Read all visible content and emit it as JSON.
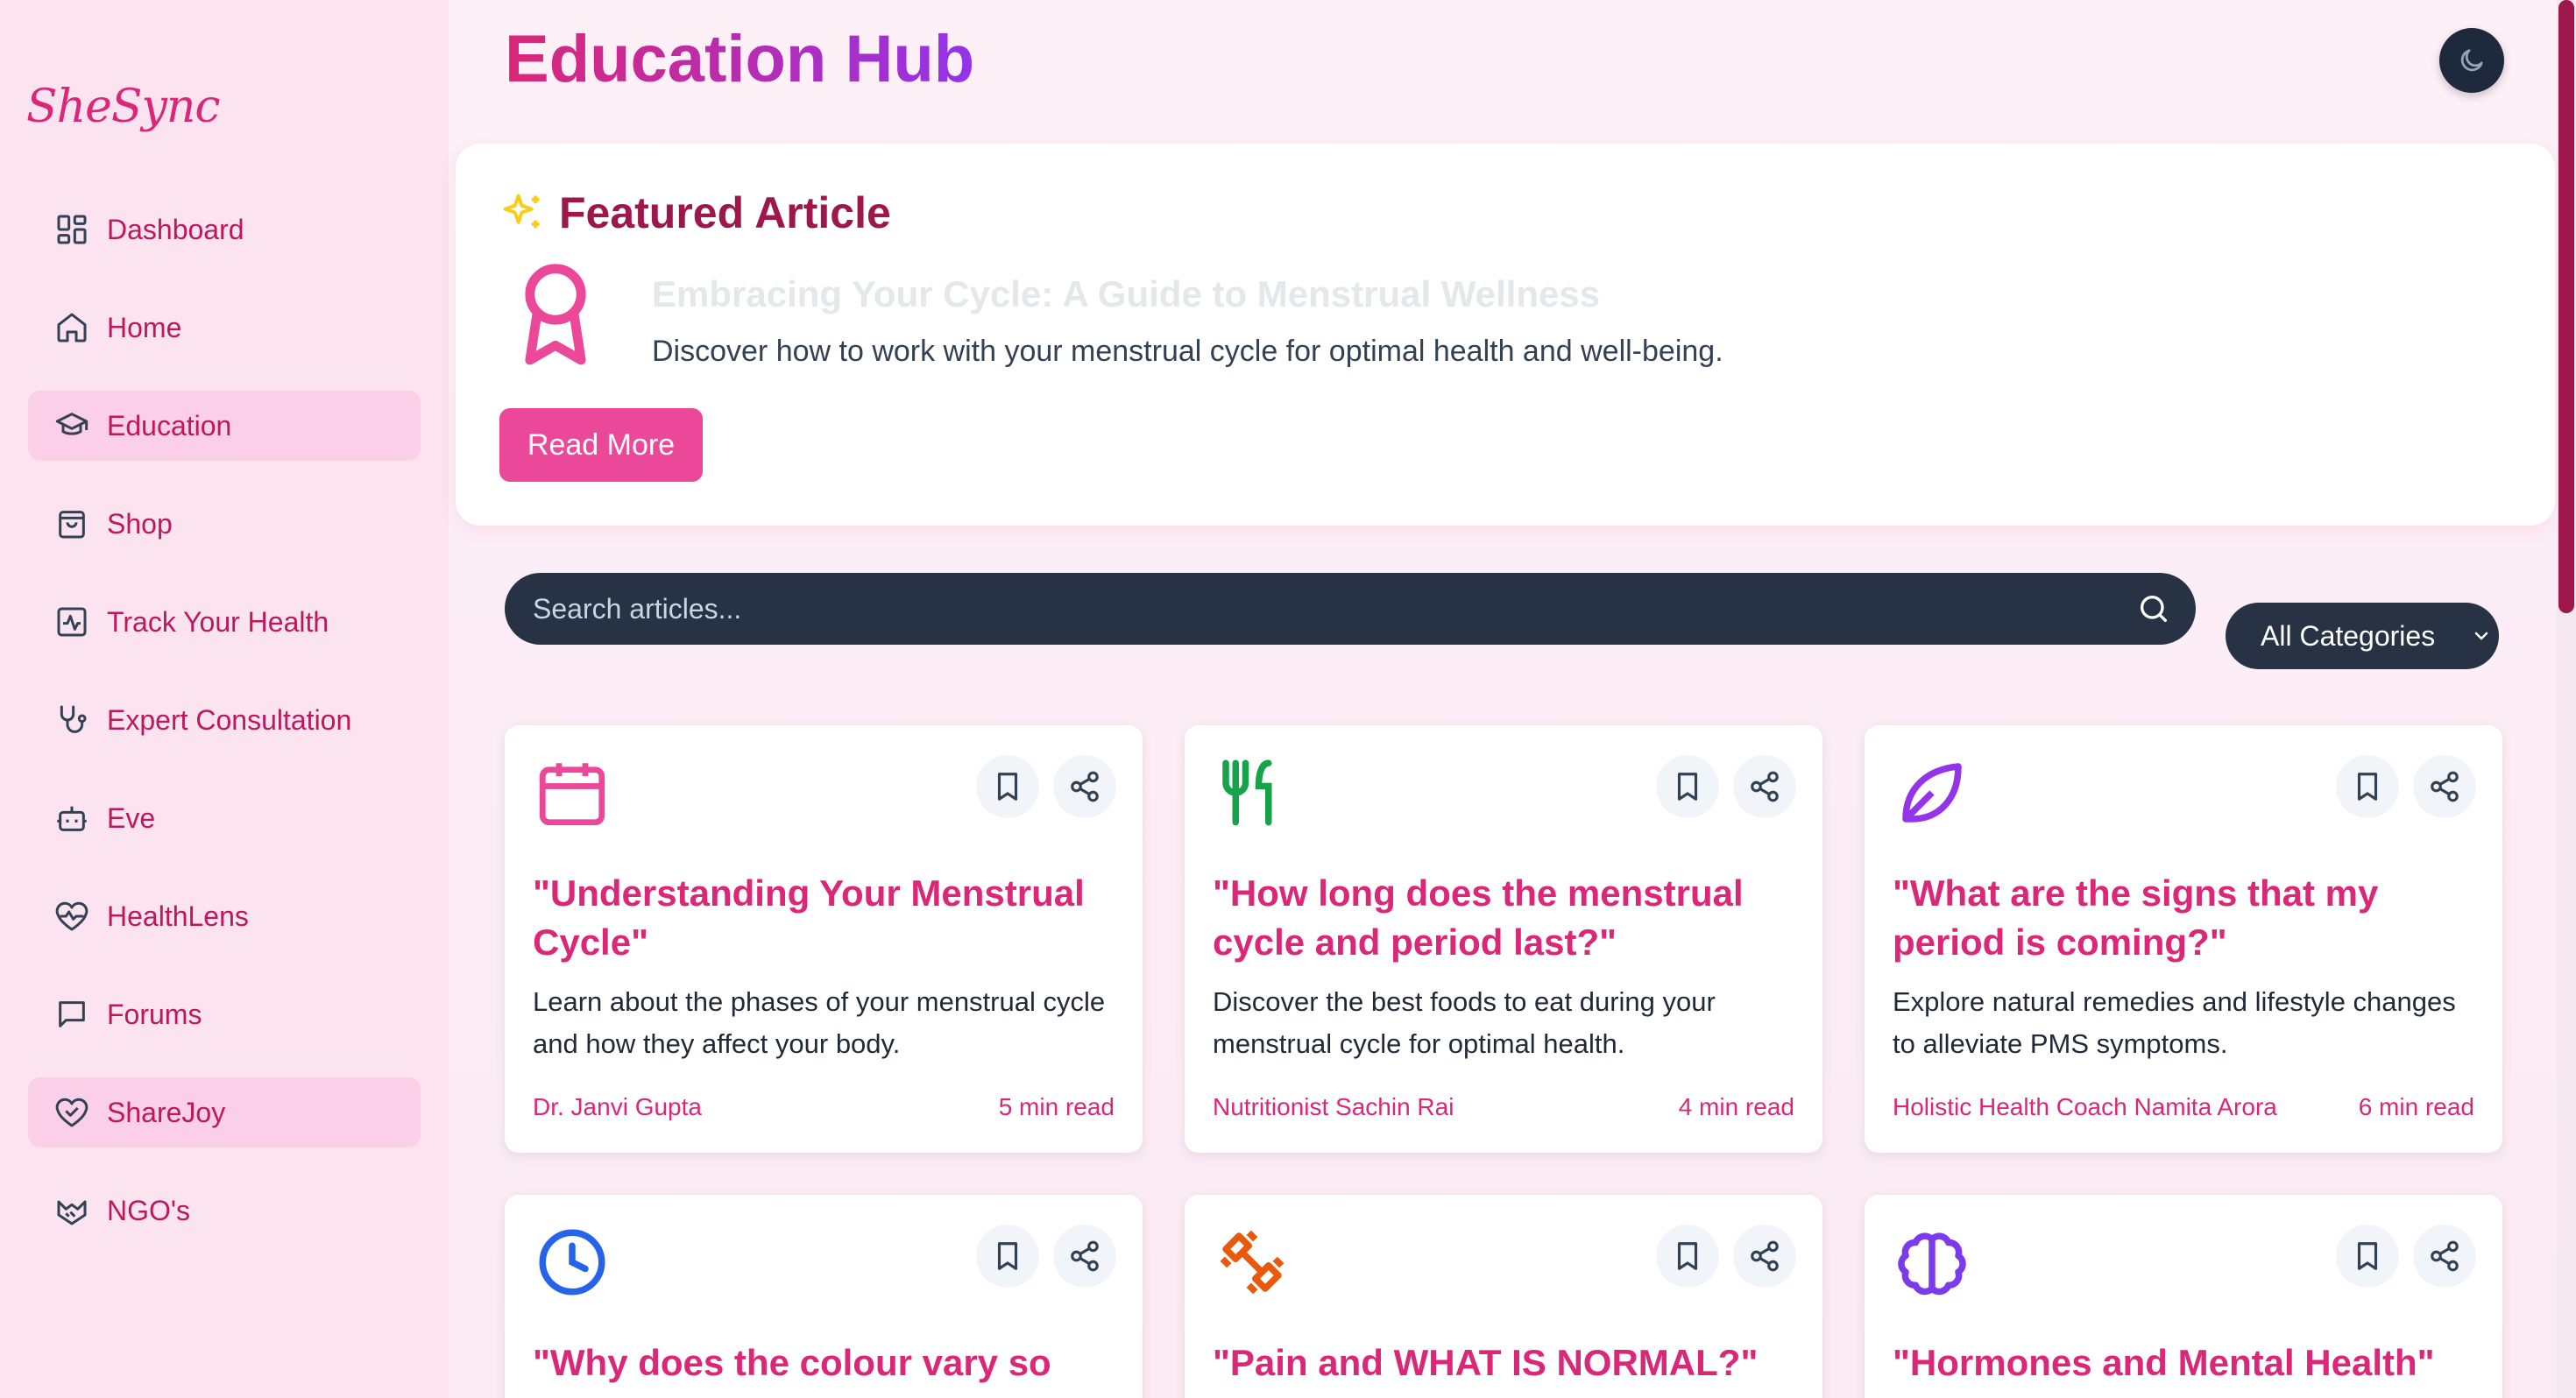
{
  "app": {
    "logo": "SheSync"
  },
  "sidebar": {
    "items": [
      {
        "label": "Dashboard",
        "icon": "dashboard-icon",
        "active": false
      },
      {
        "label": "Home",
        "icon": "home-icon",
        "active": false
      },
      {
        "label": "Education",
        "icon": "graduation-cap-icon",
        "active": true
      },
      {
        "label": "Shop",
        "icon": "shopping-bag-icon",
        "active": false
      },
      {
        "label": "Track Your Health",
        "icon": "activity-icon",
        "active": false
      },
      {
        "label": "Expert Consultation",
        "icon": "stethoscope-icon",
        "active": false
      },
      {
        "label": "Eve",
        "icon": "bot-icon",
        "active": false
      },
      {
        "label": "HealthLens",
        "icon": "heart-pulse-icon",
        "active": false
      },
      {
        "label": "Forums",
        "icon": "message-square-icon",
        "active": false
      },
      {
        "label": "ShareJoy",
        "icon": "heart-handshake-icon",
        "active": true
      },
      {
        "label": "NGO's",
        "icon": "handshake-icon",
        "active": false
      }
    ]
  },
  "header": {
    "title": "Education Hub",
    "theme_toggle_icon": "moon-icon"
  },
  "featured": {
    "heading": "Featured Article",
    "title": "Embracing Your Cycle: A Guide to Menstrual Wellness",
    "description": "Discover how to work with your menstrual cycle for optimal health and well-being.",
    "button_label": "Read More"
  },
  "search": {
    "placeholder": "Search articles...",
    "value": ""
  },
  "category_filter": {
    "selected": "All Categories"
  },
  "articles": [
    {
      "icon": "calendar-icon",
      "icon_color": "#ec4899",
      "title": "\"Understanding Your Menstrual Cycle\"",
      "description": "Learn about the phases of your menstrual cycle and how they affect your body.",
      "author": "Dr. Janvi Gupta",
      "read_time": "5 min read"
    },
    {
      "icon": "utensils-icon",
      "icon_color": "#16a34a",
      "title": "\"How long does the menstrual cycle and period last?\"",
      "description": "Discover the best foods to eat during your menstrual cycle for optimal health.",
      "author": "Nutritionist Sachin Rai",
      "read_time": "4 min read"
    },
    {
      "icon": "leaf-icon",
      "icon_color": "#9333ea",
      "title": "\"What are the signs that my period is coming?\"",
      "description": "Explore natural remedies and lifestyle changes to alleviate PMS symptoms.",
      "author": "Holistic Health Coach Namita Arora",
      "read_time": "6 min read"
    },
    {
      "icon": "clock-icon",
      "icon_color": "#2563eb",
      "title": "\"Why does the colour vary so",
      "description": "",
      "author": "",
      "read_time": ""
    },
    {
      "icon": "dumbbell-icon",
      "icon_color": "#ea580c",
      "title": "\"Pain and WHAT IS NORMAL?\"",
      "description": "",
      "author": "",
      "read_time": ""
    },
    {
      "icon": "brain-icon",
      "icon_color": "#7c3aed",
      "title": "\"Hormones and Mental Health\"",
      "description": "",
      "author": "",
      "read_time": ""
    }
  ],
  "colors": {
    "accent": "#db2777",
    "sidebar_bg": "#fbe3ef",
    "active_bg": "#fbcfe8",
    "button": "#ec4899",
    "dark": "#273244"
  }
}
